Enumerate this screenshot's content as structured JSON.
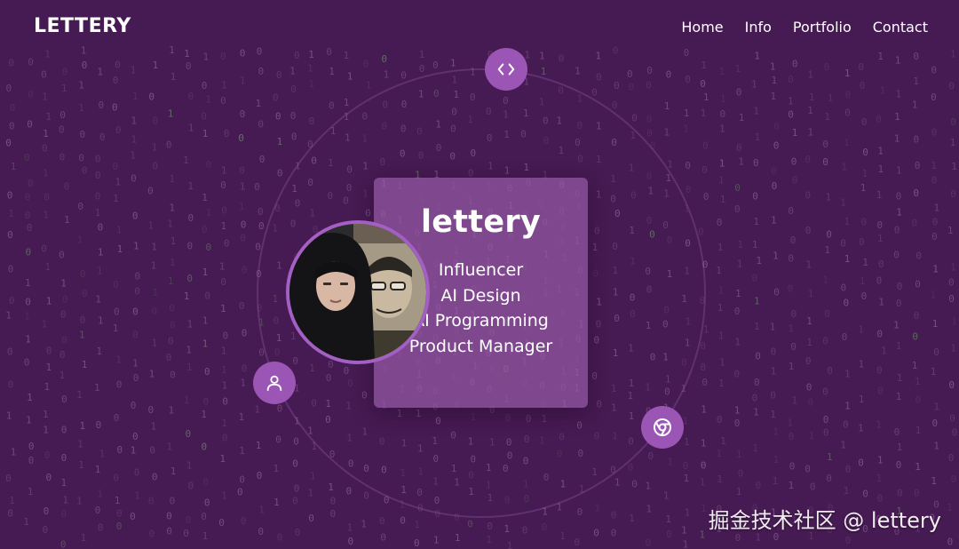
{
  "header": {
    "logo": "LETTERY",
    "nav": [
      {
        "label": "Home"
      },
      {
        "label": "Info"
      },
      {
        "label": "Portfolio"
      },
      {
        "label": "Contact"
      }
    ]
  },
  "profile": {
    "name": "lettery",
    "roles": [
      "Influencer",
      "AI Design",
      "AI Programming",
      "Product Manager"
    ]
  },
  "orbit_icons": {
    "top": "code-icon",
    "left": "user-icon",
    "right": "chrome-icon"
  },
  "background": {
    "effect": "falling binary digits",
    "digits": [
      "0",
      "1"
    ]
  },
  "watermark": "掘金技术社区 @ lettery",
  "colors": {
    "background": "#461a52",
    "accent": "#9b55b5",
    "card": "#96599f",
    "avatar_border": "#a35fc4",
    "digits": "#b48cc0",
    "digits_highlight": "#7fcf7a"
  }
}
